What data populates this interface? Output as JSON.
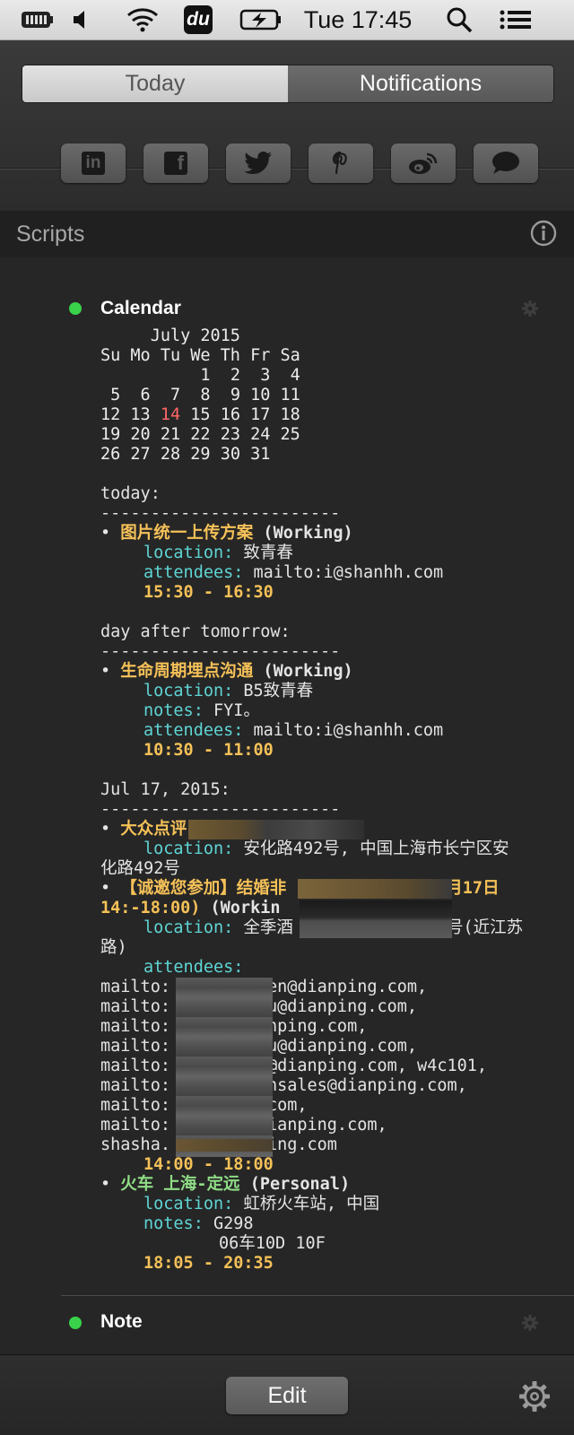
{
  "menubar": {
    "clock": "Tue 17:45",
    "app_badge": "du"
  },
  "tabs": {
    "today": "Today",
    "notifications": "Notifications"
  },
  "share_buttons": [
    {
      "name": "linkedin-icon",
      "glyph": "in"
    },
    {
      "name": "facebook-icon",
      "glyph": "f"
    },
    {
      "name": "twitter-icon"
    },
    {
      "name": "pinterest-icon"
    },
    {
      "name": "weibo-icon"
    },
    {
      "name": "messages-icon"
    }
  ],
  "scripts": {
    "title": "Scripts"
  },
  "calendar_widget": {
    "title": "Calendar",
    "month_header": "     July 2015",
    "weekday_header": "Su Mo Tu We Th Fr Sa",
    "weeks": [
      [
        "",
        "",
        "",
        "1",
        "2",
        "3",
        "4"
      ],
      [
        "5",
        "6",
        "7",
        "8",
        "9",
        "10",
        "11"
      ],
      [
        "12",
        "13",
        "14",
        "15",
        "16",
        "17",
        "18"
      ],
      [
        "19",
        "20",
        "21",
        "22",
        "23",
        "24",
        "25"
      ],
      [
        "26",
        "27",
        "28",
        "29",
        "30",
        "31",
        ""
      ]
    ],
    "today_date": "14",
    "separator": "------------------------",
    "sections": {
      "today": {
        "heading": "today:",
        "event": {
          "bullet": "• ",
          "title": "图片统一上传方案",
          "calendar": " (Working)",
          "location_key": "location:",
          "location_value": " 致青春",
          "attendees_key": "attendees:",
          "attendees_value": " mailto:i@shanhh.com",
          "time": "15:30 - 16:30"
        }
      },
      "day_after": {
        "heading": "day after tomorrow:",
        "event": {
          "bullet": "• ",
          "title": "生命周期埋点沟通",
          "calendar": " (Working)",
          "location_key": "location:",
          "location_value": " B5致青春",
          "notes_key": "notes:",
          "notes_value": " FYI。",
          "attendees_key": "attendees:",
          "attendees_value": " mailto:i@shanhh.com",
          "time": "10:30 - 11:00"
        }
      },
      "jul17": {
        "heading": "Jul 17, 2015:",
        "event1": {
          "bullet": "• ",
          "title": "大众点评",
          "location_key": "location:",
          "location_value": " 安化路492号, 中国上海市长宁区安",
          "location_cont": "化路492号"
        },
        "event2": {
          "bullet": "• ",
          "title_a": "【诚邀您参加】结婚非",
          "title_b": "月17日",
          "title_line2": "14:-18:00)",
          "calendar": " (Workin",
          "location_key": "location:",
          "location_value_a": " 全季酒",
          "location_value_b": "6号(近江苏",
          "location_cont": "路)",
          "attendees_key": "attendees:",
          "attendee_lines": [
            [
              "mailto:",
              "en@dianping.com,"
            ],
            [
              "mailto:",
              "u@dianping.com,"
            ],
            [
              "mailto:",
              "nping.com,"
            ],
            [
              "mailto:",
              "u@dianping.com,"
            ],
            [
              "mailto:",
              "@dianping.com, w4c101,"
            ],
            [
              "mailto:",
              "nsales@dianping.com,"
            ],
            [
              "mailto:",
              "com,"
            ],
            [
              "mailto:",
              "ianping.com,"
            ],
            [
              "shasha.",
              "ing.com"
            ]
          ],
          "time": "14:00 - 18:00"
        },
        "event3": {
          "bullet": "• ",
          "title": "火车 上海-定远",
          "calendar": " (Personal)",
          "location_key": "location:",
          "location_value": " 虹桥火车站, 中国",
          "notes_key": "notes:",
          "notes_value": " G298",
          "notes_line2": "06车10D 10F",
          "time": "18:05 - 20:35"
        }
      }
    }
  },
  "note_widget": {
    "title": "Note"
  },
  "bottom": {
    "edit_label": "Edit"
  },
  "colors": {
    "status_green": "#39d24a",
    "today_highlight": "#ff6767",
    "event_title": "#f5c158",
    "personal_title": "#8fdc86",
    "field_key": "#5fd4d4"
  }
}
